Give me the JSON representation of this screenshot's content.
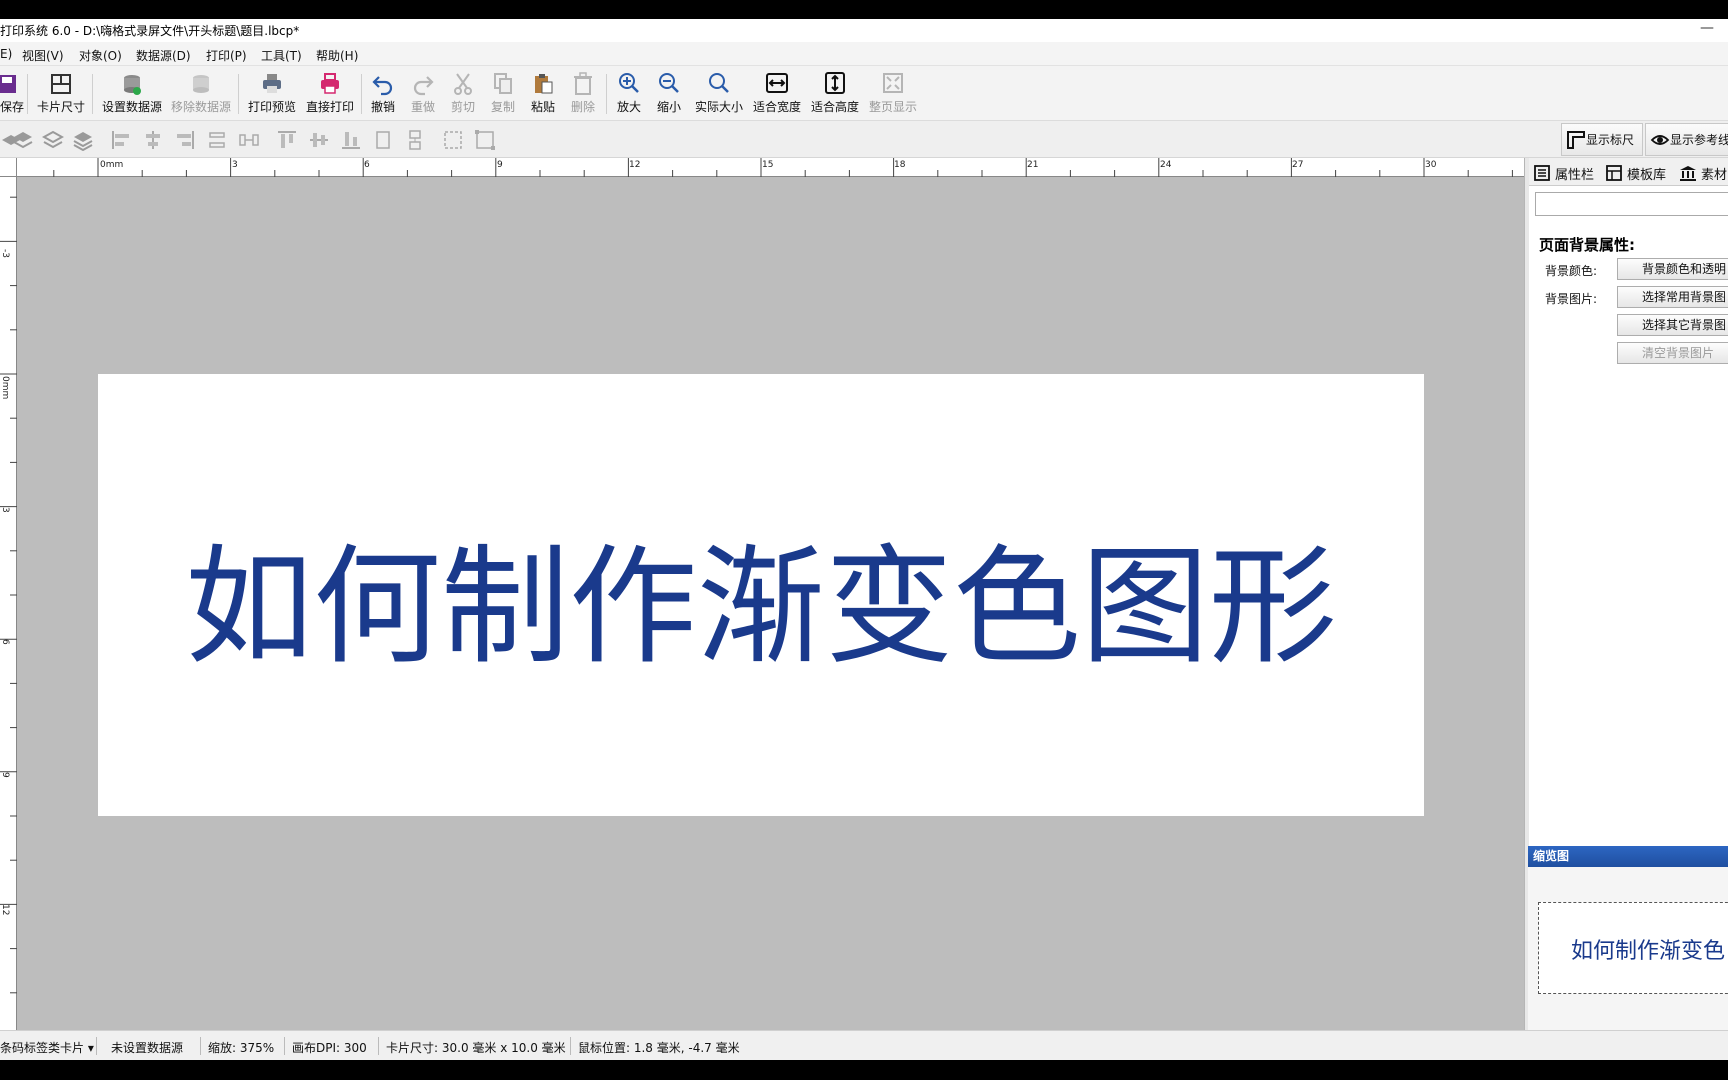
{
  "window": {
    "title": "打印系统 6.0 - D:\\嗨格式录屏文件\\开头标题\\题目.lbcp*",
    "minimize_glyph": "—"
  },
  "menu": [
    {
      "label": "E)"
    },
    {
      "label": "视图(V)"
    },
    {
      "label": "对象(O)"
    },
    {
      "label": "数据源(D)"
    },
    {
      "label": "打印(P)"
    },
    {
      "label": "工具(T)"
    },
    {
      "label": "帮助(H)"
    }
  ],
  "toolbar": [
    {
      "label": "保存",
      "icon": "save-icon",
      "enabled": true
    },
    {
      "label": "卡片尺寸",
      "icon": "card-size-icon",
      "enabled": true
    },
    {
      "label": "设置数据源",
      "icon": "database-icon",
      "enabled": true
    },
    {
      "label": "移除数据源",
      "icon": "database-remove-icon",
      "enabled": false
    },
    {
      "label": "打印预览",
      "icon": "print-preview-icon",
      "enabled": true
    },
    {
      "label": "直接打印",
      "icon": "printer-icon",
      "enabled": true
    },
    {
      "label": "撤销",
      "icon": "undo-icon",
      "enabled": true
    },
    {
      "label": "重做",
      "icon": "redo-icon",
      "enabled": false
    },
    {
      "label": "剪切",
      "icon": "scissors-icon",
      "enabled": false
    },
    {
      "label": "复制",
      "icon": "copy-icon",
      "enabled": false
    },
    {
      "label": "粘贴",
      "icon": "paste-icon",
      "enabled": true
    },
    {
      "label": "删除",
      "icon": "trash-icon",
      "enabled": false
    },
    {
      "label": "放大",
      "icon": "zoom-in-icon",
      "enabled": true
    },
    {
      "label": "缩小",
      "icon": "zoom-out-icon",
      "enabled": true
    },
    {
      "label": "实际大小",
      "icon": "zoom-actual-icon",
      "enabled": true
    },
    {
      "label": "适合宽度",
      "icon": "fit-width-icon",
      "enabled": true
    },
    {
      "label": "适合高度",
      "icon": "fit-height-icon",
      "enabled": true
    },
    {
      "label": "整页显示",
      "icon": "fit-page-icon",
      "enabled": false
    }
  ],
  "toolbar2": {
    "show_ruler": "显示标尺",
    "show_guides": "显示参考线"
  },
  "ruler": {
    "top_ticks": [
      "0mm",
      "3",
      "6",
      "9",
      "12",
      "15",
      "18",
      "21",
      "24",
      "27",
      "30"
    ],
    "left_ticks": [
      "-3",
      "0mm",
      "3",
      "6",
      "9",
      "12"
    ]
  },
  "canvas": {
    "text": "如何制作渐变色图形",
    "text_color": "#1a3a8c",
    "background": "#bdbdbd"
  },
  "right_panel": {
    "tabs": [
      {
        "label": "属性栏",
        "icon": "list-icon"
      },
      {
        "label": "模板库",
        "icon": "template-icon"
      },
      {
        "label": "素材",
        "icon": "library-icon"
      }
    ],
    "section_title": "页面背景属性:",
    "bg_color_label": "背景颜色:",
    "bg_color_btn": "背景颜色和透明",
    "bg_image_label": "背景图片:",
    "bg_image_common_btn": "选择常用背景图",
    "bg_image_other_btn": "选择其它背景图",
    "bg_image_clear_btn": "清空背景图片"
  },
  "thumbnail": {
    "title": "缩览图",
    "text": "如何制作渐变色"
  },
  "status": {
    "card_type": "条码标签类卡片",
    "datasource": "未设置数据源",
    "zoom": "缩放: 375%",
    "dpi": "画布DPI: 300",
    "card_size": "卡片尺寸: 30.0 毫米 x 10.0 毫米",
    "mouse_pos": "鼠标位置: 1.8 毫米, -4.7 毫米"
  }
}
